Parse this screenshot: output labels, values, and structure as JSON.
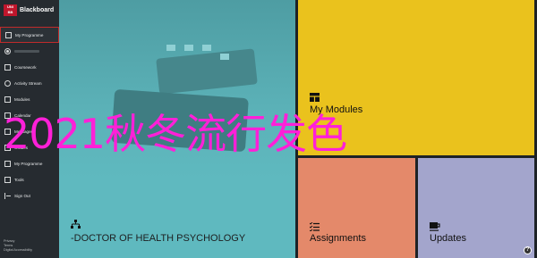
{
  "sidebar": {
    "brand": {
      "logo_text": "UNI\nBLACK",
      "name": "Blackboard"
    },
    "items": [
      {
        "label": "My Programme",
        "icon": "grid-icon",
        "active": true
      },
      {
        "label": "",
        "icon": "user-icon",
        "blurred": true
      },
      {
        "label": "Coursework",
        "icon": "book-icon"
      },
      {
        "label": "Activity Stream",
        "icon": "stream-icon"
      },
      {
        "label": "Modules",
        "icon": "modules-icon"
      },
      {
        "label": "Calendar",
        "icon": "calendar-icon"
      },
      {
        "label": "Messages",
        "icon": "messages-icon"
      },
      {
        "label": "Grades",
        "icon": "grades-icon"
      },
      {
        "label": "My Programme",
        "icon": "programme-icon"
      },
      {
        "label": "Tools",
        "icon": "tools-icon"
      },
      {
        "label": "Sign Out",
        "icon": "signout-icon"
      }
    ],
    "footer": [
      "Privacy",
      "Terms",
      "Digital Accessibility"
    ]
  },
  "tiles": {
    "programme": {
      "label": "-DOCTOR OF HEALTH PSYCHOLOGY",
      "icon": "hierarchy-icon",
      "color": "#5fb9bf"
    },
    "modules": {
      "label": "My Modules",
      "icon": "table-icon",
      "color": "#eac21d"
    },
    "assignments": {
      "label": "Assignments",
      "icon": "checklist-icon",
      "color": "#e4896a"
    },
    "updates": {
      "label": "Updates",
      "icon": "cup-icon",
      "color": "#a3a5cc"
    }
  },
  "help": {
    "label": "?"
  },
  "overlay": {
    "text": "2021秋冬流行发色",
    "color": "#ff20d8"
  }
}
